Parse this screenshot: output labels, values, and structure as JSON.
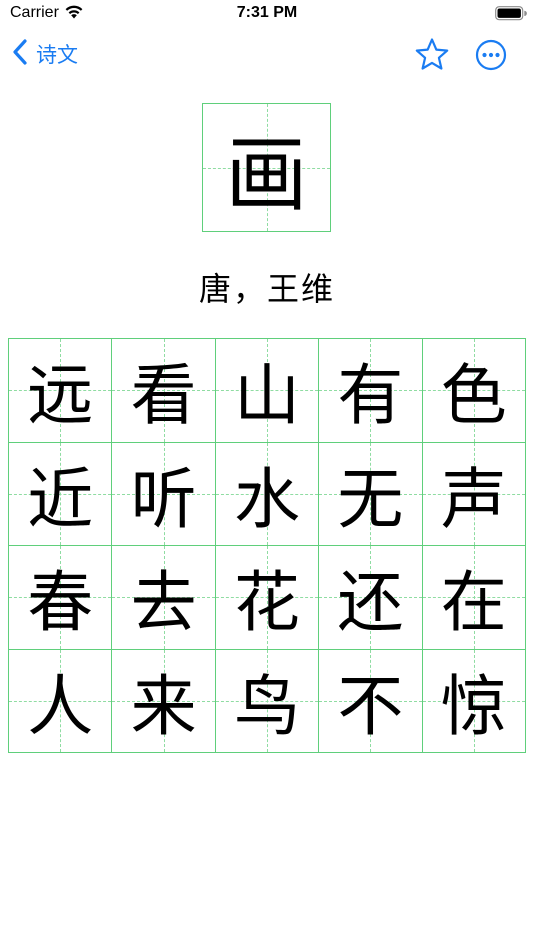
{
  "status_bar": {
    "carrier": "Carrier",
    "time": "7:31 PM"
  },
  "nav": {
    "back_label": "诗文",
    "accent_color": "#1a7cf2"
  },
  "poem": {
    "title": "画",
    "author": "唐，王维",
    "lines": [
      [
        "远",
        "看",
        "山",
        "有",
        "色"
      ],
      [
        "近",
        "听",
        "水",
        "无",
        "声"
      ],
      [
        "春",
        "去",
        "花",
        "还",
        "在"
      ],
      [
        "人",
        "来",
        "鸟",
        "不",
        "惊"
      ]
    ]
  },
  "colors": {
    "grid_line": "#5fcf7b",
    "guide_line": "#8fdca2"
  },
  "icons": {
    "back": "chevron-left-icon",
    "favorite": "star-outline-icon",
    "more": "ellipsis-circle-icon",
    "wifi": "wifi-icon",
    "battery": "battery-icon"
  }
}
